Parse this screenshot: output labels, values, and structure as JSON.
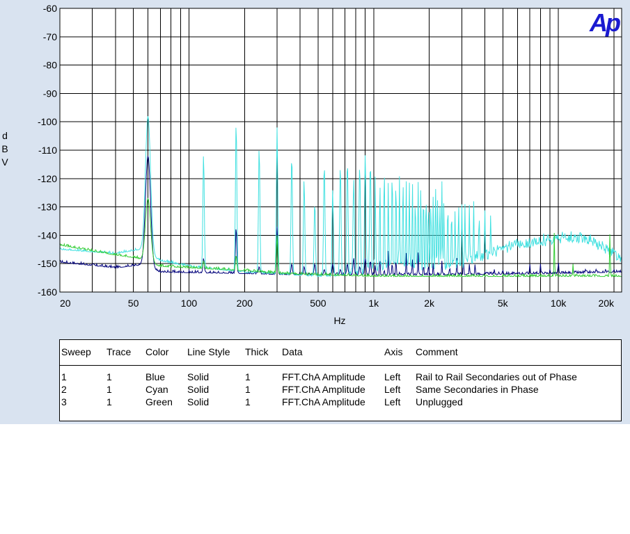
{
  "logo": "Ap",
  "chart_data": {
    "type": "line",
    "xscale": "log",
    "xlim": [
      20,
      22000
    ],
    "ylim": [
      -160,
      -60
    ],
    "xlabel": "Hz",
    "ylabel": "d\nB\nV",
    "y_ticks": [
      -60,
      -70,
      -80,
      -90,
      -100,
      -110,
      -120,
      -130,
      -140,
      -150,
      -160
    ],
    "x_ticks": [
      {
        "value": 20,
        "label": "20"
      },
      {
        "value": 50,
        "label": "50"
      },
      {
        "value": 100,
        "label": "100"
      },
      {
        "value": 200,
        "label": "200"
      },
      {
        "value": 500,
        "label": "500"
      },
      {
        "value": 1000,
        "label": "1k"
      },
      {
        "value": 2000,
        "label": "2k"
      },
      {
        "value": 5000,
        "label": "5k"
      },
      {
        "value": 10000,
        "label": "10k"
      },
      {
        "value": 20000,
        "label": "20k"
      }
    ],
    "gridlines_x": [
      20,
      30,
      40,
      50,
      60,
      70,
      80,
      90,
      100,
      200,
      300,
      400,
      500,
      600,
      700,
      800,
      900,
      1000,
      2000,
      3000,
      4000,
      5000,
      6000,
      7000,
      8000,
      9000,
      10000,
      20000
    ],
    "grid": true,
    "series": [
      {
        "name": "Blue",
        "color": "#00007a",
        "noise_floor": [
          [
            20,
            -149.5
          ],
          [
            40,
            -151.5
          ],
          [
            55,
            -150.5
          ],
          [
            70,
            -153
          ],
          [
            200,
            -153.5
          ],
          [
            400,
            -154
          ],
          [
            2000,
            -154
          ],
          [
            10000,
            -153.5
          ],
          [
            22000,
            -153
          ]
        ],
        "peaks": [
          [
            60,
            -112
          ],
          [
            120,
            -148
          ],
          [
            180,
            -137
          ],
          [
            240,
            -151
          ],
          [
            300,
            -137
          ],
          [
            360,
            -150
          ],
          [
            420,
            -151
          ],
          [
            480,
            -150
          ],
          [
            540,
            -152
          ],
          [
            600,
            -150
          ],
          [
            660,
            -152
          ],
          [
            720,
            -150
          ],
          [
            780,
            -148
          ],
          [
            840,
            -151
          ],
          [
            900,
            -148
          ],
          [
            960,
            -149
          ],
          [
            1020,
            -150
          ],
          [
            1080,
            -148
          ],
          [
            1140,
            -152
          ],
          [
            1200,
            -145
          ],
          [
            1260,
            -149
          ],
          [
            1320,
            -148
          ],
          [
            1380,
            -153
          ],
          [
            1500,
            -146
          ],
          [
            1620,
            -148
          ],
          [
            1740,
            -146
          ],
          [
            1860,
            -150
          ],
          [
            1980,
            -150
          ],
          [
            2100,
            -150
          ],
          [
            2340,
            -149
          ],
          [
            2580,
            -151
          ],
          [
            2820,
            -148
          ],
          [
            3060,
            -148
          ],
          [
            3300,
            -150
          ],
          [
            3540,
            -150
          ],
          [
            4000,
            -153
          ],
          [
            4500,
            -152
          ],
          [
            5000,
            -152
          ],
          [
            6000,
            -153
          ],
          [
            7000,
            -150
          ],
          [
            8000,
            -150
          ],
          [
            9000,
            -152
          ],
          [
            10000,
            -149
          ],
          [
            12000,
            -152
          ],
          [
            14000,
            -152
          ],
          [
            16000,
            -152
          ],
          [
            18000,
            -152
          ],
          [
            20000,
            -152
          ]
        ]
      },
      {
        "name": "Cyan",
        "color": "#40e0e0",
        "noise_floor": [
          [
            20,
            -145
          ],
          [
            40,
            -146.5
          ],
          [
            55,
            -145
          ],
          [
            70,
            -149
          ],
          [
            100,
            -151
          ],
          [
            200,
            -153
          ],
          [
            500,
            -154.5
          ],
          [
            1000,
            -154.5
          ],
          [
            22000,
            -154.5
          ]
        ],
        "envelope": [
          [
            700,
            -154.5
          ],
          [
            900,
            -152
          ],
          [
            1200,
            -150
          ],
          [
            2000,
            -151
          ],
          [
            3000,
            -150
          ],
          [
            4000,
            -147
          ],
          [
            5000,
            -145
          ],
          [
            7000,
            -143
          ],
          [
            10000,
            -141
          ],
          [
            14000,
            -141
          ],
          [
            18000,
            -145
          ],
          [
            22000,
            -148
          ]
        ],
        "peaks": [
          [
            60,
            -98
          ],
          [
            120,
            -111
          ],
          [
            180,
            -99
          ],
          [
            240,
            -108
          ],
          [
            300,
            -102
          ],
          [
            360,
            -111
          ],
          [
            420,
            -120
          ],
          [
            480,
            -128
          ],
          [
            540,
            -114
          ],
          [
            600,
            -124
          ],
          [
            660,
            -115
          ],
          [
            720,
            -113
          ],
          [
            780,
            -120
          ],
          [
            840,
            -115
          ],
          [
            900,
            -111
          ],
          [
            960,
            -114
          ],
          [
            1020,
            -114
          ],
          [
            1080,
            -117
          ],
          [
            1140,
            -110
          ],
          [
            1200,
            -120
          ],
          [
            1260,
            -110
          ],
          [
            1320,
            -114
          ],
          [
            1380,
            -118
          ],
          [
            1440,
            -115
          ],
          [
            1500,
            -120
          ],
          [
            1560,
            -121
          ],
          [
            1620,
            -119
          ],
          [
            1680,
            -123
          ],
          [
            1740,
            -121
          ],
          [
            1800,
            -120
          ],
          [
            1860,
            -121
          ],
          [
            1920,
            -122
          ],
          [
            1980,
            -124
          ],
          [
            2040,
            -125
          ],
          [
            2100,
            -126
          ],
          [
            2160,
            -120
          ],
          [
            2220,
            -125
          ],
          [
            2280,
            -126
          ],
          [
            2340,
            -121
          ],
          [
            2400,
            -126
          ],
          [
            2520,
            -126
          ],
          [
            2640,
            -128
          ],
          [
            2760,
            -130
          ],
          [
            2880,
            -127
          ],
          [
            3000,
            -129
          ],
          [
            3120,
            -129
          ],
          [
            3300,
            -128
          ],
          [
            3480,
            -128
          ],
          [
            3720,
            -131
          ],
          [
            4000,
            -131
          ],
          [
            4300,
            -132
          ]
        ]
      },
      {
        "name": "Green",
        "color": "#33cc33",
        "noise_floor": [
          [
            20,
            -143.5
          ],
          [
            40,
            -147
          ],
          [
            52,
            -148
          ],
          [
            70,
            -151
          ],
          [
            100,
            -151.5
          ],
          [
            200,
            -152.5
          ],
          [
            300,
            -153.5
          ],
          [
            500,
            -154
          ],
          [
            1000,
            -154.5
          ],
          [
            22000,
            -154.5
          ]
        ],
        "peaks": [
          [
            60,
            -127
          ],
          [
            120,
            -149
          ],
          [
            180,
            -147
          ],
          [
            300,
            -140
          ],
          [
            9500,
            -139
          ],
          [
            12000,
            -150
          ],
          [
            19000,
            -139
          ]
        ]
      }
    ]
  },
  "legend_table": {
    "headers": [
      "Sweep",
      "Trace",
      "Color",
      "Line Style",
      "Thick",
      "Data",
      "Axis",
      "Comment"
    ],
    "rows": [
      [
        "1",
        "1",
        "Blue",
        "Solid",
        "1",
        "FFT.ChA Amplitude",
        "Left",
        "Rail to Rail Secondaries out of Phase"
      ],
      [
        "2",
        "1",
        "Cyan",
        "Solid",
        "1",
        "FFT.ChA Amplitude",
        "Left",
        "Same Secondaries in Phase"
      ],
      [
        "3",
        "1",
        "Green",
        "Solid",
        "1",
        "FFT.ChA Amplitude",
        "Left",
        "Unplugged"
      ]
    ]
  }
}
